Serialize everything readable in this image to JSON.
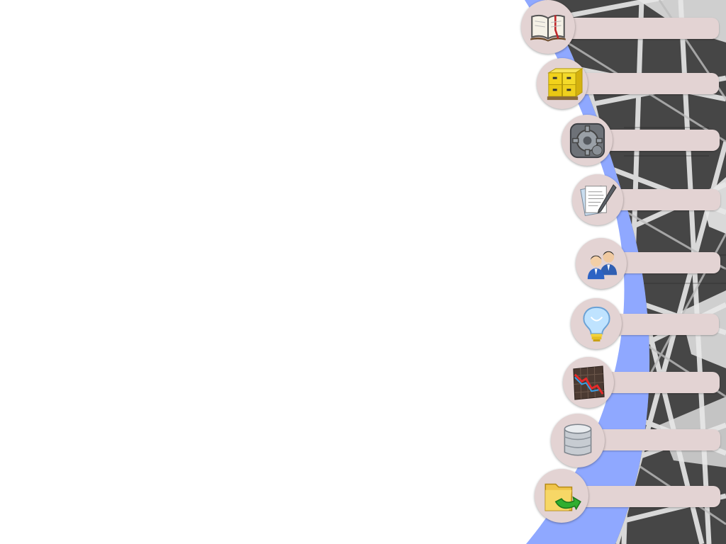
{
  "colors": {
    "menu_pink": "#e3d3d3",
    "side_blue": "#8fa8ff",
    "photo_dark": "#3c3c3c"
  },
  "menu": {
    "items": [
      {
        "id": "book",
        "icon": "open-book-icon",
        "label": ""
      },
      {
        "id": "boxes",
        "icon": "cardboard-boxes-icon",
        "label": ""
      },
      {
        "id": "settings",
        "icon": "gear-icon",
        "label": ""
      },
      {
        "id": "document",
        "icon": "document-pen-icon",
        "label": ""
      },
      {
        "id": "users",
        "icon": "users-icon",
        "label": ""
      },
      {
        "id": "idea",
        "icon": "lightbulb-icon",
        "label": ""
      },
      {
        "id": "chart",
        "icon": "declining-chart-icon",
        "label": ""
      },
      {
        "id": "database",
        "icon": "database-icon",
        "label": ""
      },
      {
        "id": "folder",
        "icon": "folder-arrow-icon",
        "label": ""
      }
    ]
  }
}
